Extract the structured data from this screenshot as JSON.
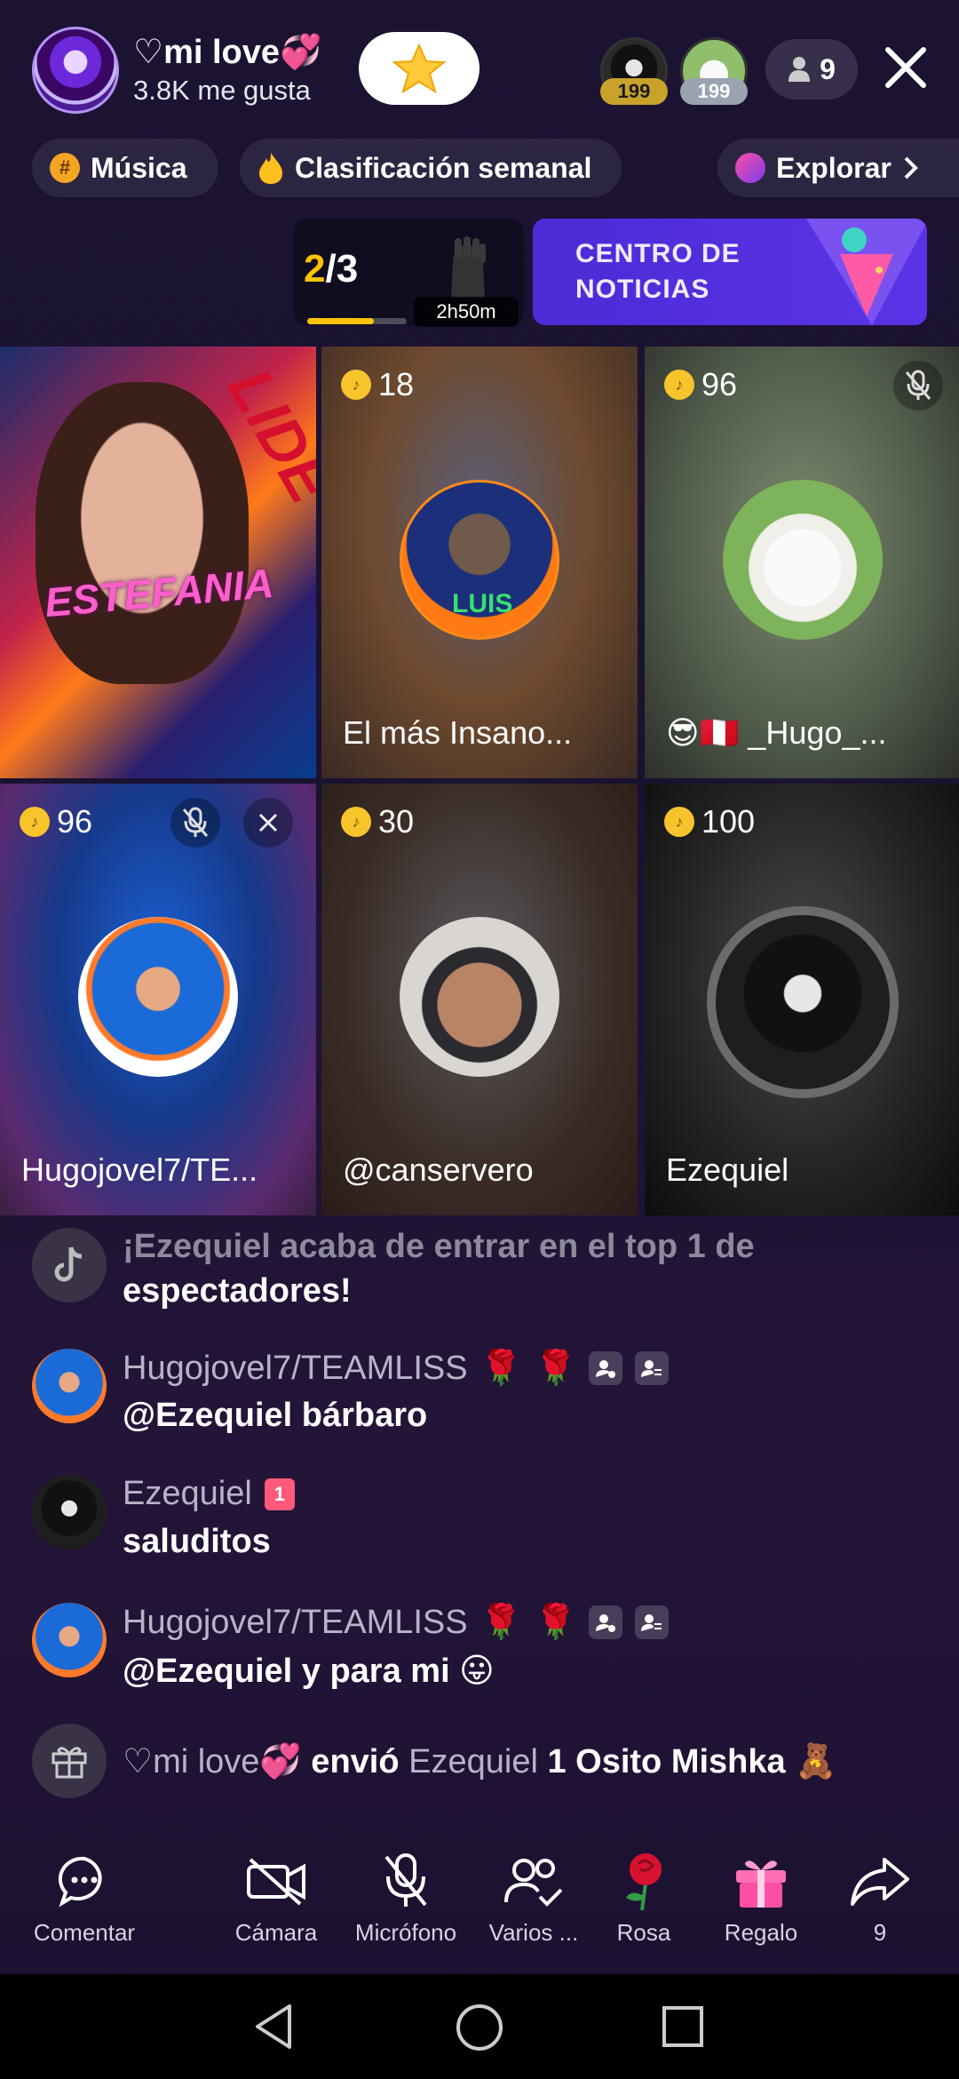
{
  "header": {
    "host_name": "♡mi love💞",
    "host_likes": "3.8K me gusta",
    "top_viewers": [
      {
        "badge": "199",
        "icon": "anonymous-mask-avatar"
      },
      {
        "badge": "199",
        "icon": "puppy-avatar"
      }
    ],
    "viewer_count": "9",
    "close_icon": "close-icon"
  },
  "chips": {
    "musica": "Música",
    "ranking": "Clasificación semanal",
    "explorar": "Explorar"
  },
  "progress": {
    "current": "2",
    "total": "/3",
    "fraction": 0.67,
    "timer": "2h50m"
  },
  "news": {
    "label": "CENTRO DE NOTICIAS"
  },
  "grid": {
    "host": {
      "tag": "LIDE",
      "name_art": "ESTEFANIA"
    },
    "tiles": [
      {
        "coins": "18",
        "name": "El más Insano...",
        "avatar_text": "LUIS"
      },
      {
        "coins": "96",
        "name": "😎🇵🇪 _Hugo_...",
        "muted": true
      },
      {
        "coins": "96",
        "name": "Hugojovel7/TE...",
        "muted": true
      },
      {
        "coins": "30",
        "name": "@canservero"
      },
      {
        "coins": "100",
        "name": "Ezequiel"
      }
    ]
  },
  "chat": {
    "system_line1": "¡Ezequiel acaba de entrar en el top 1 de",
    "system_line2": "espectadores!",
    "messages": [
      {
        "user": "Hugojovel7/TEAMLISS",
        "text": "@Ezequiel bárbaro"
      },
      {
        "user": "Ezequiel",
        "text": "saluditos"
      },
      {
        "user": "Hugojovel7/TEAMLISS",
        "text": "@Ezequiel y para mi 😛"
      }
    ],
    "gift": {
      "sender": "♡mi love💞",
      "verb": " envió ",
      "receiver": "Ezequiel",
      "item": " 1 Osito Mishka 🧸"
    }
  },
  "bottom_bar": {
    "comentar": "Comentar",
    "camara": "Cámara",
    "microfono": "Micrófono",
    "varios": "Varios ...",
    "rosa": "Rosa",
    "regalo": "Regalo",
    "share_count": "9"
  },
  "colors": {
    "accent_yellow": "#ffc400",
    "news_purple": "#5b33e6",
    "coin_gold": "#f7c52b"
  }
}
